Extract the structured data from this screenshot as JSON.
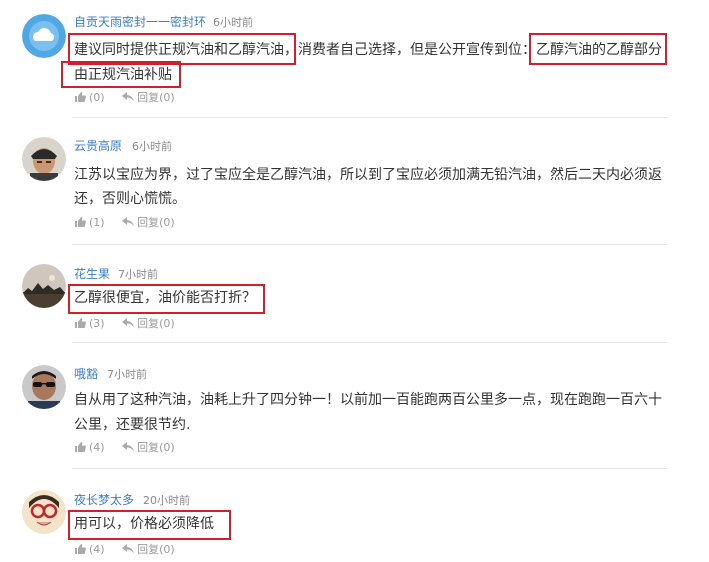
{
  "comments": [
    {
      "username": "自贡天雨密封一一密封环",
      "time": "6小时前",
      "lines": [
        "建议同时提供正规汽油和乙醇汽油，消费者自己选择，但是公开宣传到位：乙醇汽油的乙醇部分",
        "由正规汽油补贴"
      ],
      "likes": "(0)",
      "reply": "回复(0)",
      "avatar": "cloud-avatar"
    },
    {
      "username": "云贵高原",
      "time": "6小时前",
      "lines": [
        "江苏以宝应为界，过了宝应全是乙醇汽油，所以到了宝应必须加满无铅汽油，然后二天内必须返",
        "还，否则心慌慌。"
      ],
      "likes": "(1)",
      "reply": "回复(0)",
      "avatar": "cap-man-avatar"
    },
    {
      "username": "花生果",
      "time": "7小时前",
      "lines": [
        "乙醇很便宜，油价能否打折？"
      ],
      "likes": "(3)",
      "reply": "回复(0)",
      "avatar": "sunset-avatar"
    },
    {
      "username": "哦豁",
      "time": "7小时前",
      "lines": [
        "自从用了这种汽油，油耗上升了四分钟一！以前加一百能跑两百公里多一点，现在跑跑一百六十",
        "公里，还要很节约."
      ],
      "likes": "(4)",
      "reply": "回复(0)",
      "avatar": "sunglasses-avatar"
    },
    {
      "username": "夜长梦太多",
      "time": "20小时前",
      "lines": [
        "用可以，价格必须降低"
      ],
      "likes": "(4)",
      "reply": "回复(0)",
      "avatar": "cartoon-glasses-avatar"
    }
  ],
  "colors": {
    "highlight": "#d21f2b",
    "username": "#3a7ecb",
    "meta": "#9a9a9a"
  }
}
